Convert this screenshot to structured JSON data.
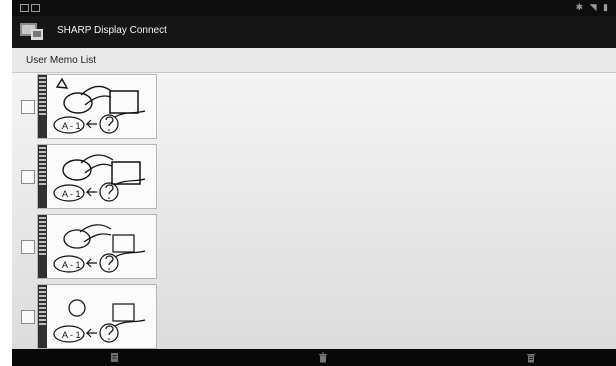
{
  "app": {
    "title": "SHARP Display Connect",
    "icon": "sharp-display-connect-icon"
  },
  "list": {
    "title": "User Memo List"
  },
  "memos": [
    {
      "thumb_text": "A - 1",
      "checked": false
    },
    {
      "thumb_text": "A - 1",
      "checked": false
    },
    {
      "thumb_text": "A - 1",
      "checked": false
    },
    {
      "thumb_text": "A - 1",
      "checked": false
    }
  ],
  "bottom_actions": [
    {
      "icon": "memo-icon"
    },
    {
      "icon": "trash-icon"
    },
    {
      "icon": "delete-all-icon"
    }
  ]
}
